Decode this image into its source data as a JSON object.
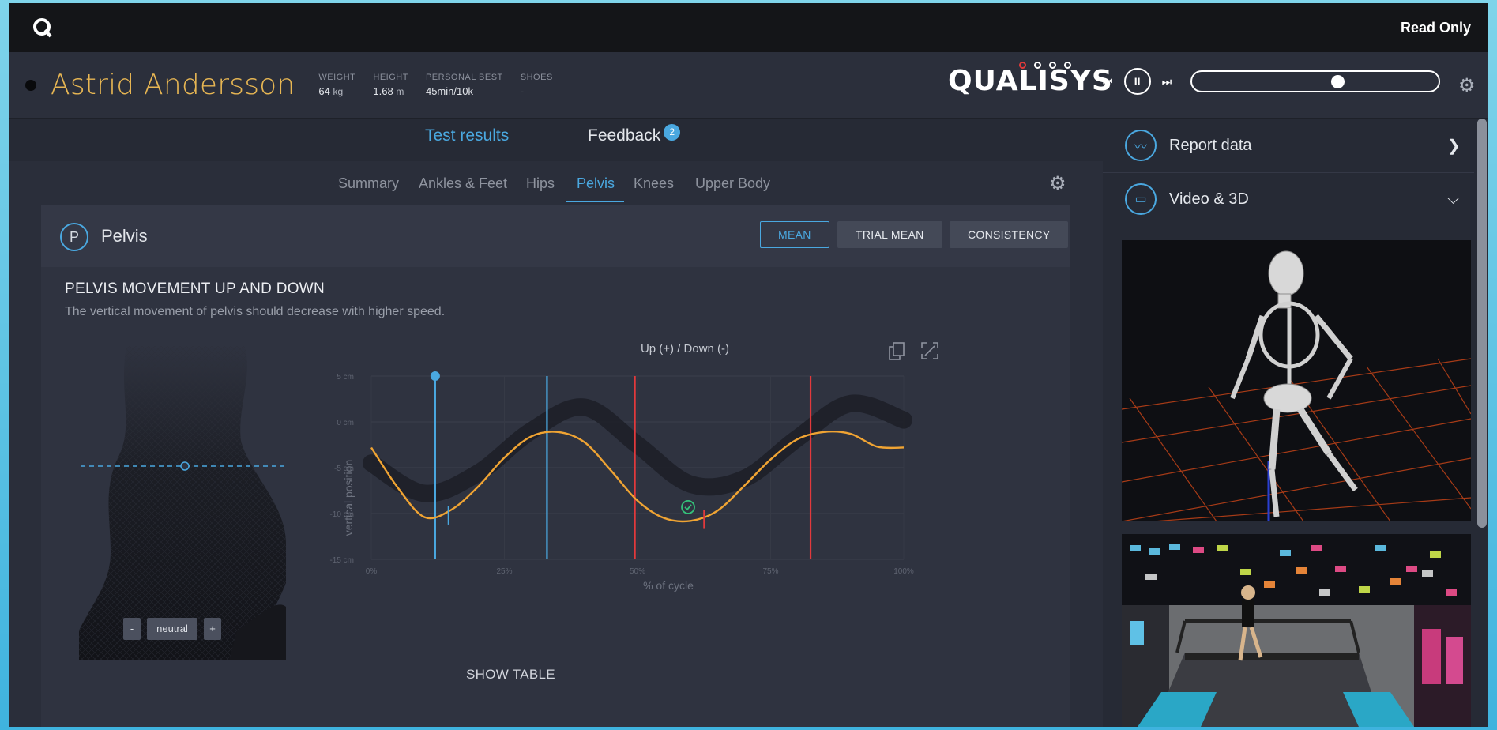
{
  "topbar": {
    "logo_letter": "Q",
    "read_only": "Read Only"
  },
  "athlete": {
    "name": "Astrid Andersson",
    "stats": [
      {
        "label": "WEIGHT",
        "value": "64",
        "unit": "kg"
      },
      {
        "label": "HEIGHT",
        "value": "1.68",
        "unit": "m"
      },
      {
        "label": "PERSONAL BEST",
        "value": "45min/10k",
        "unit": ""
      },
      {
        "label": "SHOES",
        "value": "-",
        "unit": ""
      }
    ]
  },
  "brand": "QUALISYS",
  "player": {
    "prev": "⏮",
    "pause": "II",
    "next": "⏭",
    "progress": 0.6
  },
  "main_tabs": {
    "test_results": "Test results",
    "feedback": "Feedback",
    "feedback_badge": "2"
  },
  "subtabs": [
    "Summary",
    "Ankles & Feet",
    "Hips",
    "Pelvis",
    "Knees",
    "Upper Body"
  ],
  "panel": {
    "icon_letter": "P",
    "title": "Pelvis",
    "buttons": {
      "mean": "MEAN",
      "trial_mean": "TRIAL MEAN",
      "consistency": "CONSISTENCY"
    },
    "metric_title": "PELVIS MOVEMENT UP AND DOWN",
    "metric_desc": "The vertical movement of pelvis should decrease with higher speed.",
    "model_controls": {
      "minus": "-",
      "neutral": "neutral",
      "plus": "+"
    },
    "show_table": "SHOW TABLE"
  },
  "chart_data": {
    "type": "line",
    "title": "Up (+) / Down (-)",
    "xlabel": "% of cycle",
    "ylabel": "vertical position",
    "xlim": [
      0,
      100
    ],
    "ylim": [
      -15,
      5
    ],
    "x_ticks": [
      "0%",
      "25%",
      "50%",
      "75%",
      "100%"
    ],
    "y_ticks": [
      "5 cm",
      "0 cm",
      "-5 cm",
      "-10 cm",
      "-15 cm"
    ],
    "series": [
      {
        "x": [
          0,
          5,
          10,
          15,
          20,
          25,
          30,
          35,
          40,
          45,
          50,
          55,
          60,
          65,
          70,
          75,
          80,
          85,
          90,
          95,
          100
        ],
        "values": [
          -2.8,
          -7.2,
          -10.4,
          -9.6,
          -7.1,
          -3.9,
          -1.6,
          -1.1,
          -2.2,
          -5.3,
          -8.6,
          -10.5,
          -10.8,
          -9.7,
          -7.0,
          -4.1,
          -1.9,
          -1.1,
          -1.3,
          -2.7,
          -2.8
        ],
        "color": "#f0a433"
      }
    ],
    "band": {
      "x": [
        0,
        10,
        20,
        30,
        40,
        50,
        60,
        70,
        80,
        90,
        100
      ],
      "values": [
        -4.5,
        -7.8,
        -5.6,
        -1.0,
        1.6,
        -2.5,
        -6.8,
        -6.2,
        -1.8,
        2.0,
        0.2
      ],
      "color": "#1c1f27"
    },
    "vertical_markers": [
      {
        "x": 12,
        "color": "#4aa8e0"
      },
      {
        "x": 33,
        "color": "#4aa8e0"
      },
      {
        "x": 49.5,
        "color": "#e2393c"
      },
      {
        "x": 82.5,
        "color": "#e2393c"
      }
    ],
    "grid": true
  },
  "right_panel": {
    "report_data": "Report data",
    "video_3d": "Video & 3D"
  },
  "colors": {
    "accent": "#4aa8e0",
    "name": "#e7b653",
    "curve": "#f0a433",
    "marker_red": "#e2393c"
  }
}
